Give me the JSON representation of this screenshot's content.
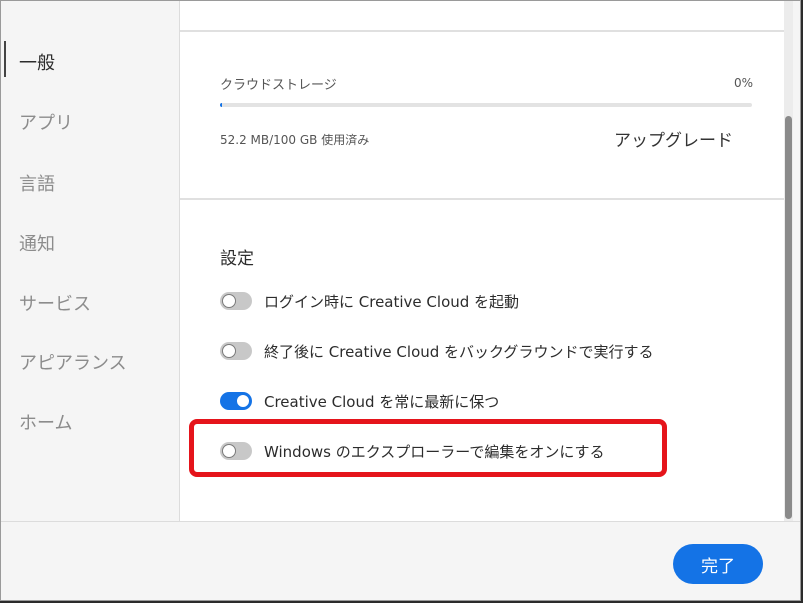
{
  "sidebar": {
    "items": [
      {
        "label": "一般",
        "active": true
      },
      {
        "label": "アプリ"
      },
      {
        "label": "言語"
      },
      {
        "label": "通知"
      },
      {
        "label": "サービス"
      },
      {
        "label": "アピアランス"
      },
      {
        "label": "ホーム"
      }
    ]
  },
  "storage": {
    "label": "クラウドストレージ",
    "percent_text": "0%",
    "used_fraction": 0.0005,
    "used_text": "52.2 MB/100 GB 使用済み",
    "upgrade_label": "アップグレード"
  },
  "settings": {
    "title": "設定",
    "toggles": [
      {
        "label": "ログイン時に Creative Cloud を起動",
        "on": false
      },
      {
        "label": "終了後に Creative Cloud をバックグラウンドで実行する",
        "on": false
      },
      {
        "label": "Creative Cloud を常に最新に保つ",
        "on": true
      },
      {
        "label": "Windows のエクスプローラーで編集をオンにする",
        "on": false
      }
    ]
  },
  "footer": {
    "done_label": "完了"
  },
  "colors": {
    "accent": "#1473e6",
    "highlight": "#e5141b"
  }
}
